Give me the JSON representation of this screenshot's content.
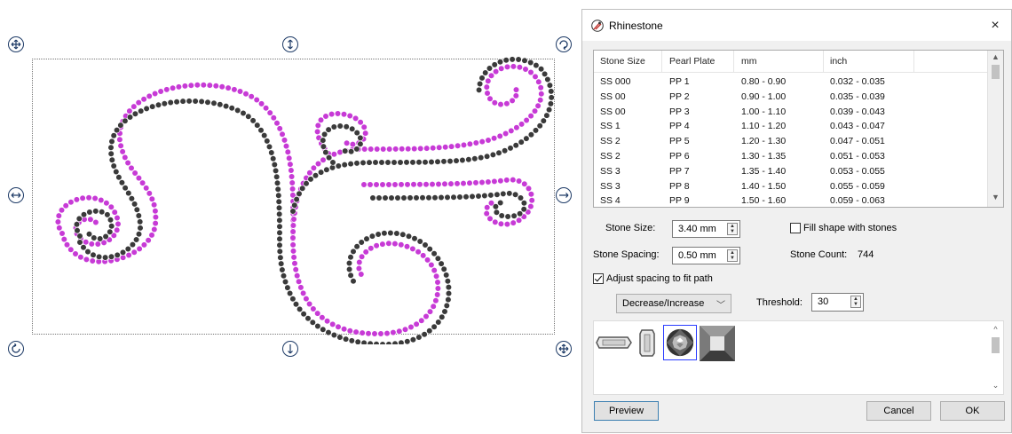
{
  "canvas": {
    "handles": [
      "move-icon",
      "resize-vertical-icon",
      "rotate-icon",
      "resize-horizontal-icon",
      "resize-horizontal-icon",
      "rotate-icon",
      "resize-vertical-icon",
      "move-icon"
    ],
    "colors": {
      "outer_stones": "#c73ad6",
      "inner_stones": "#3a3a3a",
      "handle": "#1d3a66"
    }
  },
  "dialog": {
    "title": "Rhinestone",
    "close_label": "×",
    "table": {
      "headers": [
        "Stone Size",
        "Pearl Plate",
        "mm",
        "inch"
      ],
      "rows": [
        [
          "SS 000",
          "PP 1",
          "0.80 - 0.90",
          "0.032 - 0.035"
        ],
        [
          "SS 00",
          "PP 2",
          "0.90 - 1.00",
          "0.035 - 0.039"
        ],
        [
          "SS 00",
          "PP 3",
          "1.00 - 1.10",
          "0.039 - 0.043"
        ],
        [
          "SS 1",
          "PP 4",
          "1.10 - 1.20",
          "0.043 - 0.047"
        ],
        [
          "SS 2",
          "PP 5",
          "1.20 - 1.30",
          "0.047 - 0.051"
        ],
        [
          "SS 2",
          "PP 6",
          "1.30 - 1.35",
          "0.051 - 0.053"
        ],
        [
          "SS 3",
          "PP 7",
          "1.35 - 1.40",
          "0.053 - 0.055"
        ],
        [
          "SS 3",
          "PP 8",
          "1.40 - 1.50",
          "0.055 - 0.059"
        ],
        [
          "SS 4",
          "PP 9",
          "1.50 - 1.60",
          "0.059 - 0.063"
        ]
      ]
    },
    "stone_size": {
      "label": "Stone Size:",
      "value": "3.40 mm"
    },
    "fill_shape": {
      "label": "Fill shape with stones",
      "checked": false
    },
    "stone_spacing": {
      "label": "Stone Spacing:",
      "value": "0.50 mm"
    },
    "stone_count": {
      "label": "Stone Count:",
      "value": "744"
    },
    "adjust_spacing": {
      "label": "Adjust spacing to fit path",
      "checked": true
    },
    "mode_select": {
      "value": "Decrease/Increase"
    },
    "threshold": {
      "label": "Threshold:",
      "value": "30"
    },
    "stone_shapes": [
      "baguette-stone-icon",
      "tall-baguette-stone-icon",
      "round-faceted-stone-icon",
      "square-stud-stone-icon"
    ],
    "buttons": {
      "preview": "Preview",
      "cancel": "Cancel",
      "ok": "OK"
    }
  }
}
